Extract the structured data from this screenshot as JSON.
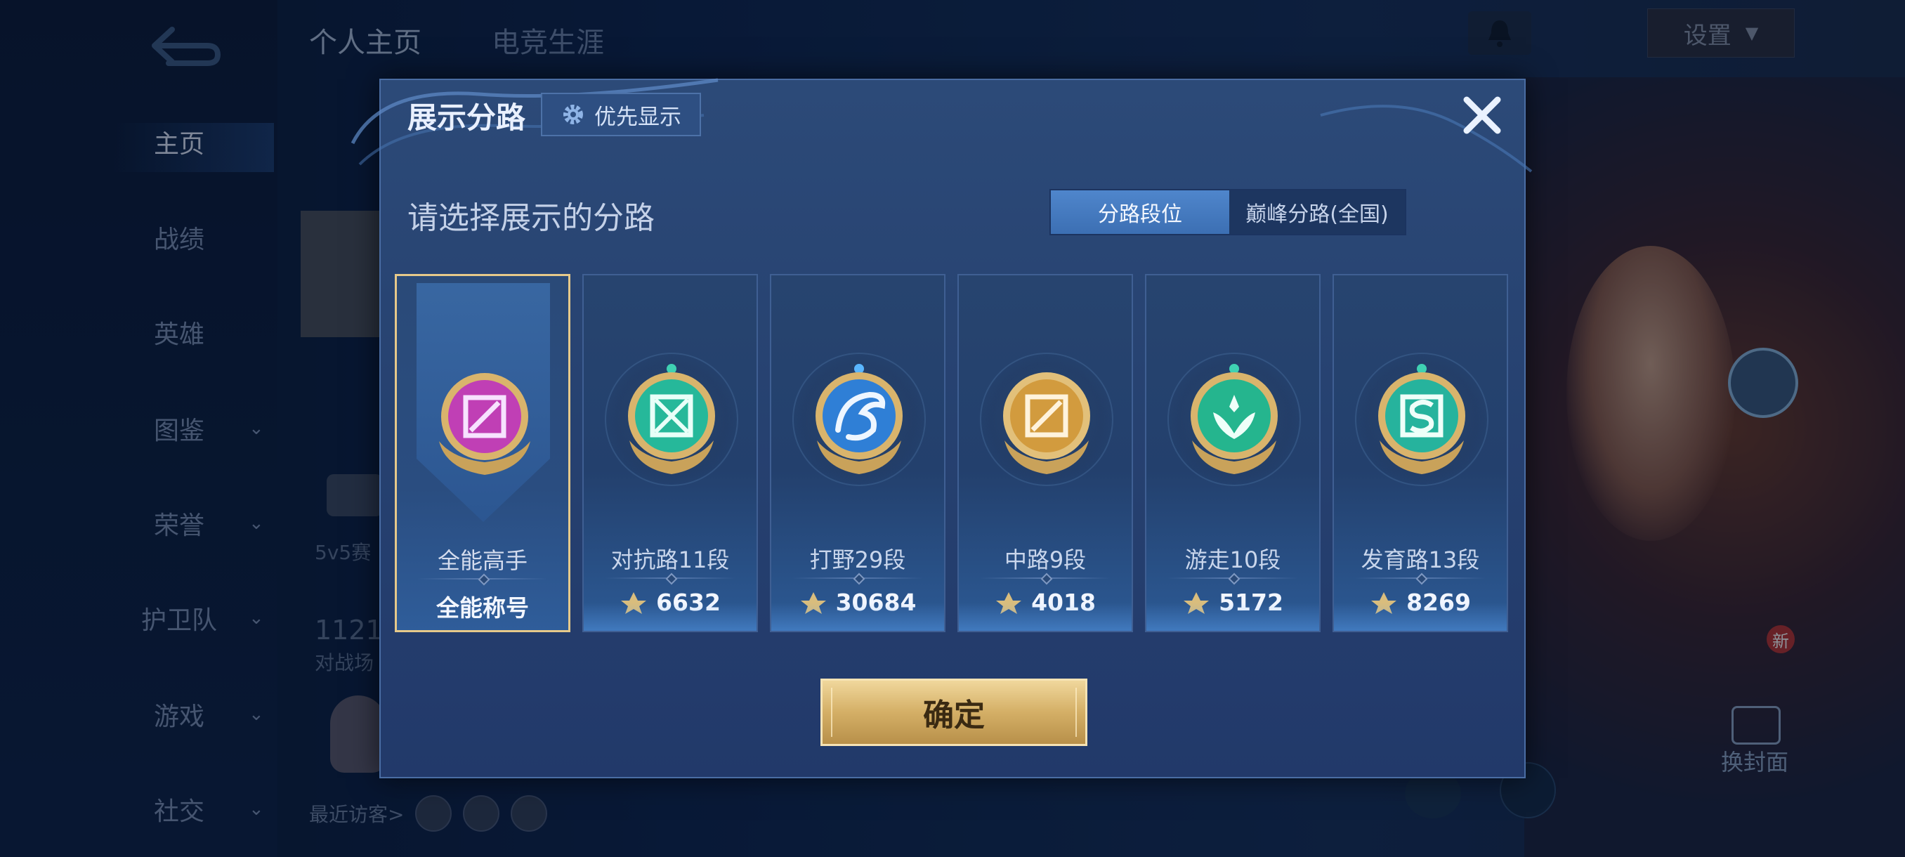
{
  "background": {
    "top_tabs": [
      "个人主页",
      "电竞生涯"
    ],
    "settings_label": "设置",
    "nav": [
      {
        "label": "主页",
        "has_chevron": false
      },
      {
        "label": "战绩",
        "has_chevron": false
      },
      {
        "label": "英雄",
        "has_chevron": false
      },
      {
        "label": "图鉴",
        "has_chevron": true
      },
      {
        "label": "荣誉",
        "has_chevron": true
      },
      {
        "label": "护卫队",
        "has_chevron": true
      },
      {
        "label": "游戏",
        "has_chevron": true
      },
      {
        "label": "社交",
        "has_chevron": true
      }
    ],
    "bg_text_1": "5v5赛",
    "bg_text_2": "1121",
    "bg_text_3": "对战场",
    "recent_visitors": "最近访客>",
    "change_cover": "换封面",
    "new_tag": "新"
  },
  "modal": {
    "title": "展示分路",
    "priority_label": "优先显示",
    "subtitle": "请选择展示的分路",
    "toggle": {
      "active": "分路段位",
      "inactive": "巅峰分路(全国)"
    },
    "cards": [
      {
        "rank": "全能高手",
        "score": "全能称号",
        "selected": true,
        "badge_color": "#c03fb5",
        "icon": "all-round-icon"
      },
      {
        "rank": "对抗路11段",
        "score": "6632",
        "selected": false,
        "badge_color": "#26b89a",
        "icon": "clash-lane-icon"
      },
      {
        "rank": "打野29段",
        "score": "30684",
        "selected": false,
        "badge_color": "#2f7fd6",
        "icon": "jungle-icon"
      },
      {
        "rank": "中路9段",
        "score": "4018",
        "selected": false,
        "badge_color": "#d29b3e",
        "icon": "mid-lane-icon"
      },
      {
        "rank": "游走10段",
        "score": "5172",
        "selected": false,
        "badge_color": "#25b58e",
        "icon": "roam-icon"
      },
      {
        "rank": "发育路13段",
        "score": "8269",
        "selected": false,
        "badge_color": "#26b39d",
        "icon": "farm-lane-icon"
      }
    ],
    "confirm_label": "确定"
  },
  "colors": {
    "gold": "#e6c98a",
    "accent_blue": "#4f86cc",
    "panel": "#264170"
  }
}
